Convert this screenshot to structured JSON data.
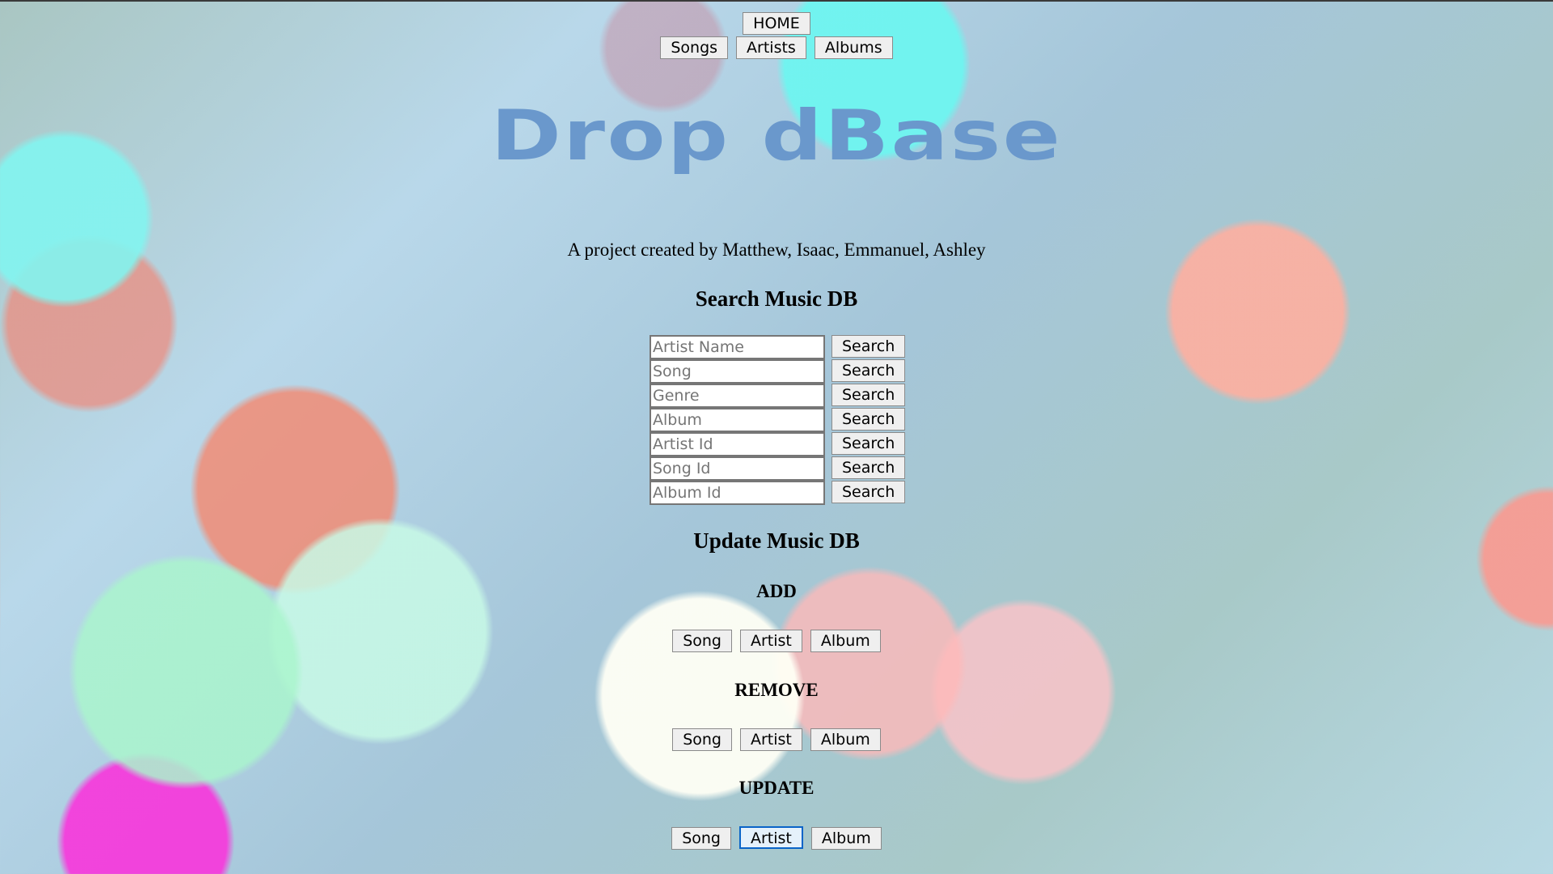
{
  "nav": {
    "home_label": "HOME",
    "items": [
      {
        "label": "Songs"
      },
      {
        "label": "Artists"
      },
      {
        "label": "Albums"
      }
    ]
  },
  "header": {
    "title": "Drop dBase",
    "credits": "A project created by Matthew, Isaac, Emmanuel, Ashley"
  },
  "search": {
    "heading": "Search Music DB",
    "fields": [
      {
        "placeholder": "Artist Name",
        "value": "",
        "button": "Search"
      },
      {
        "placeholder": "Song",
        "value": "",
        "button": "Search"
      },
      {
        "placeholder": "Genre",
        "value": "",
        "button": "Search"
      },
      {
        "placeholder": "Album",
        "value": "",
        "button": "Search"
      },
      {
        "placeholder": "Artist Id",
        "value": "",
        "button": "Search"
      },
      {
        "placeholder": "Song Id",
        "value": "",
        "button": "Search"
      },
      {
        "placeholder": "Album Id",
        "value": "",
        "button": "Search"
      }
    ]
  },
  "update": {
    "heading": "Update Music DB",
    "add": {
      "label": "ADD",
      "buttons": [
        "Song",
        "Artist",
        "Album"
      ]
    },
    "remove": {
      "label": "REMOVE",
      "buttons": [
        "Song",
        "Artist",
        "Album"
      ]
    },
    "modify": {
      "label": "UPDATE",
      "buttons": [
        "Song",
        "Artist",
        "Album"
      ],
      "focused": "Artist"
    }
  },
  "colors": {
    "title": "#6a98cc",
    "focus_border": "#0a64c8"
  }
}
